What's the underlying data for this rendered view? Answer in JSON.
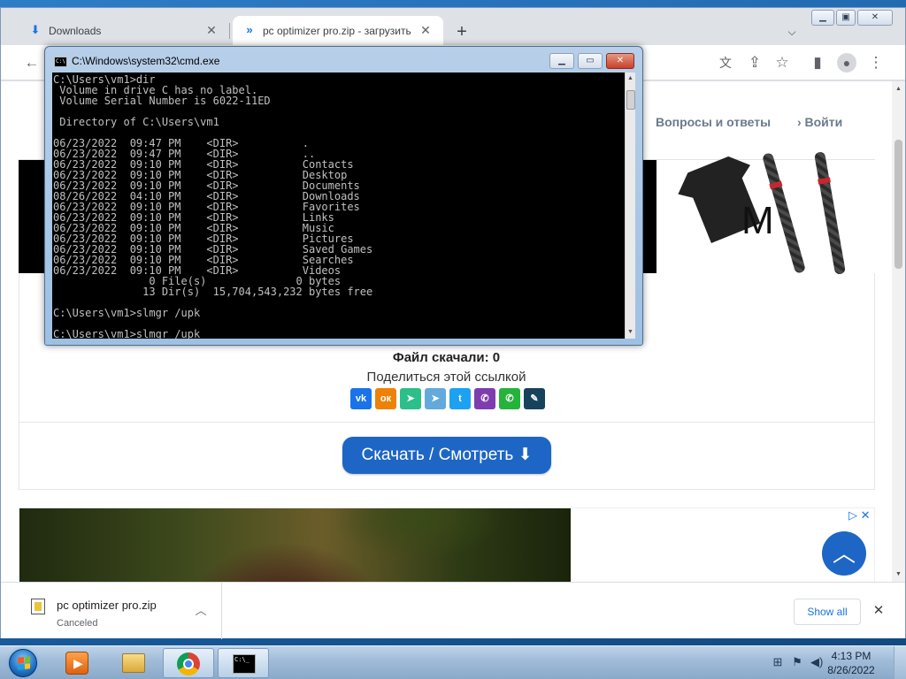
{
  "taskbar": {
    "clock_time": "4:13 PM",
    "clock_date": "8/26/2022",
    "pinned": [
      "windows-media-player",
      "windows-explorer",
      "google-chrome",
      "command-prompt"
    ]
  },
  "browser": {
    "tabs": [
      {
        "title": "Downloads",
        "icon": "download-icon",
        "active": false
      },
      {
        "title": "pc optimizer pro.zip - загрузить",
        "icon": "chevron-link-icon",
        "active": true
      }
    ],
    "new_tab": "+",
    "toolbar_icons": [
      "back-icon",
      "translate-icon",
      "share-icon",
      "bookmark-star-icon",
      "side-panel-icon",
      "profile-icon",
      "menu-icon"
    ]
  },
  "page": {
    "nav": {
      "faq": "Вопросы и ответы",
      "login": "Войти"
    },
    "ad_letter": "M",
    "downloads_count": "Файл скачали: 0",
    "share_label": "Поделиться этой ссылкой",
    "share_buttons": [
      {
        "name": "vk",
        "glyph": "vk",
        "color": "#1a73e8"
      },
      {
        "name": "odnoklassniki",
        "glyph": "ок",
        "color": "#ee8208"
      },
      {
        "name": "agent",
        "glyph": "➤",
        "color": "#2bbf8a"
      },
      {
        "name": "telegram",
        "glyph": "➤",
        "color": "#64a9dc"
      },
      {
        "name": "twitter",
        "glyph": "t",
        "color": "#1da1f2"
      },
      {
        "name": "viber",
        "glyph": "✆",
        "color": "#7d3daf"
      },
      {
        "name": "whatsapp",
        "glyph": "✆",
        "color": "#25b33b"
      },
      {
        "name": "livejournal",
        "glyph": "✎",
        "color": "#17425c"
      }
    ],
    "download_button": "Скачать / Смотреть ⬇",
    "ad_choices": "▷ ✕",
    "scroll_top": "︿"
  },
  "download_shelf": {
    "filename": "pc optimizer pro.zip",
    "status": "Canceled",
    "show_all": "Show all"
  },
  "cmd": {
    "title": "C:\\Windows\\system32\\cmd.exe",
    "output": "C:\\Users\\vm1>dir\n Volume in drive C has no label.\n Volume Serial Number is 6022-11ED\n\n Directory of C:\\Users\\vm1\n\n06/23/2022  09:47 PM    <DIR>          .\n06/23/2022  09:47 PM    <DIR>          ..\n06/23/2022  09:10 PM    <DIR>          Contacts\n06/23/2022  09:10 PM    <DIR>          Desktop\n06/23/2022  09:10 PM    <DIR>          Documents\n08/26/2022  04:10 PM    <DIR>          Downloads\n06/23/2022  09:10 PM    <DIR>          Favorites\n06/23/2022  09:10 PM    <DIR>          Links\n06/23/2022  09:10 PM    <DIR>          Music\n06/23/2022  09:10 PM    <DIR>          Pictures\n06/23/2022  09:10 PM    <DIR>          Saved Games\n06/23/2022  09:10 PM    <DIR>          Searches\n06/23/2022  09:10 PM    <DIR>          Videos\n               0 File(s)              0 bytes\n              13 Dir(s)  15,704,543,232 bytes free\n\nC:\\Users\\vm1>slmgr /upk\n\nC:\\Users\\vm1>slmgr /upk"
  }
}
